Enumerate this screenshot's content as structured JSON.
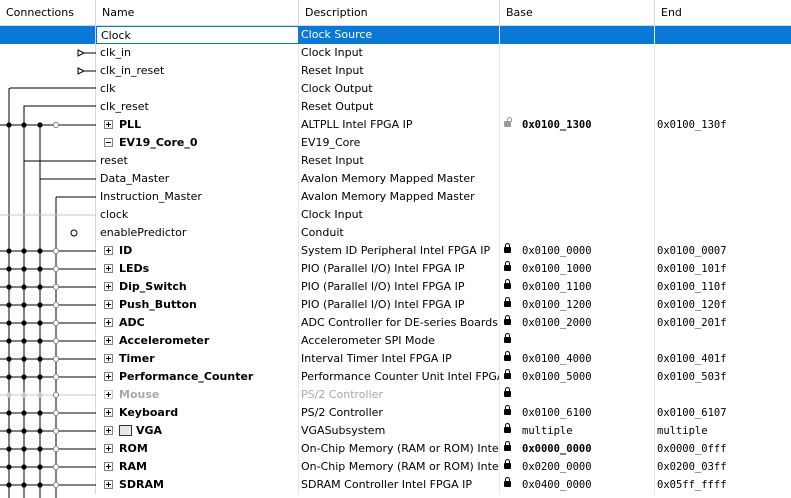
{
  "header": {
    "connections": "Connections",
    "name": "Name",
    "description": "Description",
    "base": "Base",
    "end": "End"
  },
  "rows": [
    {
      "name": "Clock",
      "desc": "Clock Source",
      "base": "",
      "end": "",
      "selected": true
    },
    {
      "name": "clk_in",
      "desc": "Clock Input",
      "base": "",
      "end": ""
    },
    {
      "name": "clk_in_reset",
      "desc": "Reset Input",
      "base": "",
      "end": ""
    },
    {
      "name": "clk",
      "desc": "Clock Output",
      "base": "",
      "end": ""
    },
    {
      "name": "clk_reset",
      "desc": "Reset Output",
      "base": "",
      "end": ""
    },
    {
      "name": "PLL",
      "desc": "ALTPLL Intel FPGA IP",
      "base": "0x0100_1300",
      "end": "0x0100_130f"
    },
    {
      "name": "EV19_Core_0",
      "desc": "EV19_Core",
      "base": "",
      "end": ""
    },
    {
      "name": "reset",
      "desc": "Reset Input",
      "base": "",
      "end": ""
    },
    {
      "name": "Data_Master",
      "desc": "Avalon Memory Mapped Master",
      "base": "",
      "end": ""
    },
    {
      "name": "Instruction_Master",
      "desc": "Avalon Memory Mapped Master",
      "base": "",
      "end": ""
    },
    {
      "name": "clock",
      "desc": "Clock Input",
      "base": "",
      "end": ""
    },
    {
      "name": "enablePredictor",
      "desc": "Conduit",
      "base": "",
      "end": ""
    },
    {
      "name": "ID",
      "desc": "System ID Peripheral Intel FPGA IP",
      "base": "0x0100_0000",
      "end": "0x0100_0007"
    },
    {
      "name": "LEDs",
      "desc": "PIO (Parallel I/O) Intel FPGA IP",
      "base": "0x0100_1000",
      "end": "0x0100_101f"
    },
    {
      "name": "Dip_Switch",
      "desc": "PIO (Parallel I/O) Intel FPGA IP",
      "base": "0x0100_1100",
      "end": "0x0100_110f"
    },
    {
      "name": "Push_Button",
      "desc": "PIO (Parallel I/O) Intel FPGA IP",
      "base": "0x0100_1200",
      "end": "0x0100_120f"
    },
    {
      "name": "ADC",
      "desc": "ADC Controller for DE-series Boards",
      "base": "0x0100_2000",
      "end": "0x0100_201f"
    },
    {
      "name": "Accelerometer",
      "desc": "Accelerometer SPI Mode",
      "base": "",
      "end": ""
    },
    {
      "name": "Timer",
      "desc": "Interval Timer Intel FPGA IP",
      "base": "0x0100_4000",
      "end": "0x0100_401f"
    },
    {
      "name": "Performance_Counter",
      "desc": "Performance Counter Unit Intel FPGA IP",
      "base": "0x0100_5000",
      "end": "0x0100_503f"
    },
    {
      "name": "Mouse",
      "desc": "PS/2 Controller",
      "base": "",
      "end": ""
    },
    {
      "name": "Keyboard",
      "desc": "PS/2 Controller",
      "base": "0x0100_6100",
      "end": "0x0100_6107"
    },
    {
      "name": "VGA",
      "desc": "VGASubsystem",
      "base": "multiple",
      "end": "multiple"
    },
    {
      "name": "ROM",
      "desc": "On-Chip Memory (RAM or ROM) Intel ...",
      "base": "0x0000_0000",
      "end": "0x0000_0fff"
    },
    {
      "name": "RAM",
      "desc": "On-Chip Memory (RAM or ROM) Intel ...",
      "base": "0x0200_0000",
      "end": "0x0200_03ff"
    },
    {
      "name": "SDRAM",
      "desc": "SDRAM Controller Intel FPGA IP",
      "base": "0x0400_0000",
      "end": "0x05ff_ffff"
    }
  ],
  "icons": {
    "expand": "plus-square-icon",
    "collapse": "minus-square-icon",
    "lock": "lock-icon",
    "unlock": "unlock-icon",
    "display": "display-icon"
  },
  "colors": {
    "selection": "#0a78d7",
    "grid": "#e6e6e6",
    "disabled": "#a8a8a8"
  }
}
